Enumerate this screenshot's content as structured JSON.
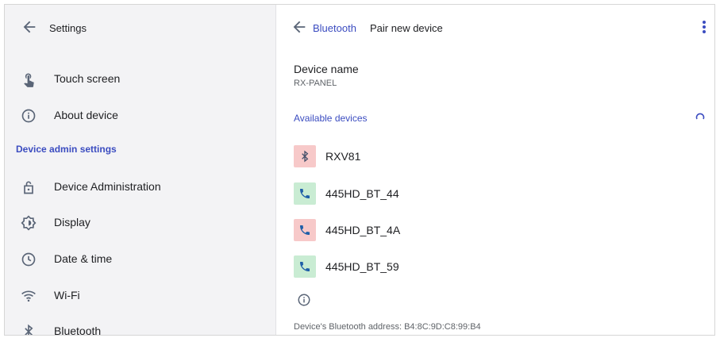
{
  "left_panel": {
    "back_label": "Settings",
    "items_top": [
      {
        "label": "Touch screen",
        "icon": "touch-icon"
      },
      {
        "label": "About device",
        "icon": "info-icon"
      }
    ],
    "section_title": "Device admin settings",
    "items_admin": [
      {
        "label": "Device Administration",
        "icon": "lock-open-icon"
      },
      {
        "label": "Display",
        "icon": "display-brightness-icon"
      },
      {
        "label": "Date & time",
        "icon": "clock-icon"
      },
      {
        "label": "Wi-Fi",
        "icon": "wifi-icon"
      },
      {
        "label": "Bluetooth",
        "icon": "bluetooth-icon"
      }
    ]
  },
  "right_panel": {
    "breadcrumb_parent": "Bluetooth",
    "title": "Pair new device",
    "device_name_title": "Device name",
    "device_name_value": "RX-PANEL",
    "available_title": "Available devices",
    "devices": [
      {
        "name": "RXV81",
        "icon": "bluetooth-icon",
        "color": "#f7c9c9"
      },
      {
        "name": "445HD_BT_44",
        "icon": "phone-icon",
        "color": "#c9ecd3"
      },
      {
        "name": "445HD_BT_4A",
        "icon": "phone-icon",
        "color": "#f7c9c9"
      },
      {
        "name": "445HD_BT_59",
        "icon": "phone-icon",
        "color": "#c9ecd3"
      }
    ],
    "address_text": "Device's Bluetooth address: B4:8C:9D:C8:99:B4"
  },
  "colors": {
    "accent": "#3b4cc0",
    "icon": "#5a6577"
  }
}
